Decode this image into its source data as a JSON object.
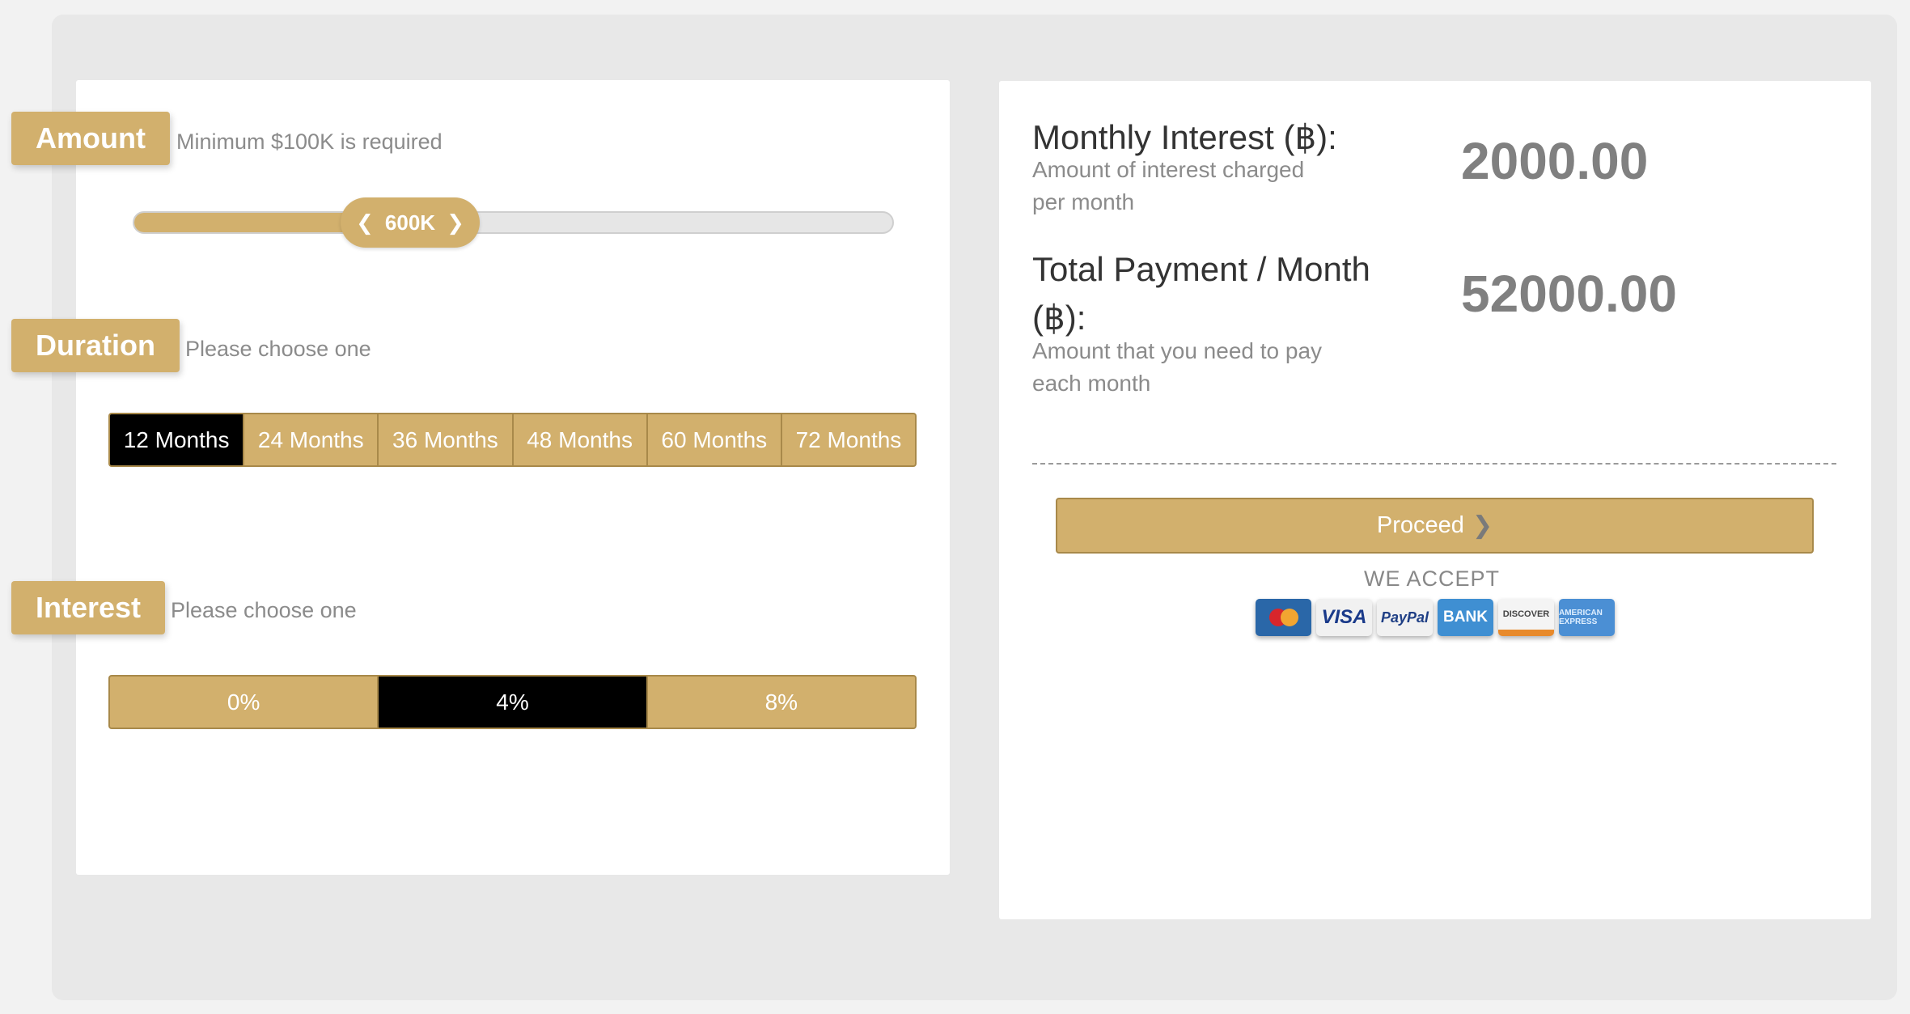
{
  "amount": {
    "label": "Amount",
    "hint": "Minimum $100K is required",
    "slider_value_label": "600K",
    "slider_fill_percent": 40
  },
  "duration": {
    "label": "Duration",
    "hint": "Please choose one",
    "options": [
      "12 Months",
      "24 Months",
      "36 Months",
      "48 Months",
      "60 Months",
      "72 Months"
    ],
    "selected": "12 Months"
  },
  "interest": {
    "label": "Interest",
    "hint": "Please choose one",
    "options": [
      "0%",
      "4%",
      "8%"
    ],
    "selected": "4%"
  },
  "summary": {
    "monthly_interest_label": "Monthly Interest (฿):",
    "monthly_interest_desc": "Amount of interest charged per month",
    "monthly_interest_value": "2000.00",
    "total_payment_label": "Total Payment / Month (฿):",
    "total_payment_desc": "Amount that you need to pay each month",
    "total_payment_value": "52000.00"
  },
  "proceed_label": "Proceed",
  "we_accept": "WE ACCEPT",
  "payment_methods": [
    {
      "name": "mastercard-icon",
      "text": ""
    },
    {
      "name": "visa-icon",
      "text": "VISA"
    },
    {
      "name": "paypal-icon",
      "text": "PayPal"
    },
    {
      "name": "bank-icon",
      "text": "BANK"
    },
    {
      "name": "discover-icon",
      "text": "DISCOVER"
    },
    {
      "name": "amex-icon",
      "text": "AMERICAN EXPRESS"
    }
  ],
  "colors": {
    "accent": "#d2b06d",
    "selected": "#000000",
    "value_text": "#808080"
  }
}
